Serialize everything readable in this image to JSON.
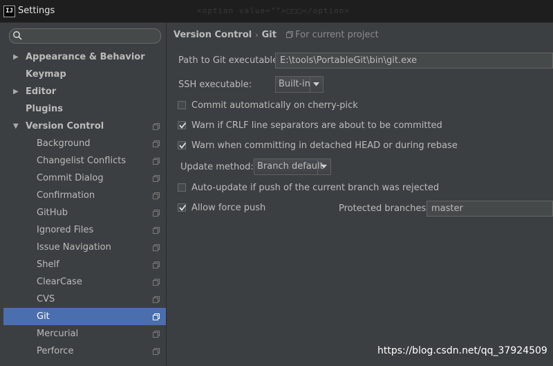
{
  "window": {
    "title": "Settings",
    "app_icon": "IJ",
    "background_code": "<option value=\"\">□□□</option>"
  },
  "sidebar": {
    "search": {
      "value": "",
      "placeholder": ""
    },
    "items": [
      {
        "label": "Appearance & Behavior",
        "level": 0,
        "arrow": "▶"
      },
      {
        "label": "Keymap",
        "level": 0
      },
      {
        "label": "Editor",
        "level": 0,
        "arrow": "▶"
      },
      {
        "label": "Plugins",
        "level": 0
      },
      {
        "label": "Version Control",
        "level": 0,
        "arrow": "▼"
      },
      {
        "label": "Background",
        "level": 1
      },
      {
        "label": "Changelist Conflicts",
        "level": 1
      },
      {
        "label": "Commit Dialog",
        "level": 1
      },
      {
        "label": "Confirmation",
        "level": 1
      },
      {
        "label": "GitHub",
        "level": 1
      },
      {
        "label": "Ignored Files",
        "level": 1
      },
      {
        "label": "Issue Navigation",
        "level": 1
      },
      {
        "label": "Shelf",
        "level": 1
      },
      {
        "label": "ClearCase",
        "level": 1
      },
      {
        "label": "CVS",
        "level": 1
      },
      {
        "label": "Git",
        "level": 1,
        "selected": true
      },
      {
        "label": "Mercurial",
        "level": 1
      },
      {
        "label": "Perforce",
        "level": 1
      }
    ]
  },
  "breadcrumb": {
    "parent": "Version Control",
    "separator": "›",
    "current": "Git",
    "scope_hint": "For current project"
  },
  "git": {
    "path_label": "Path to Git executable:",
    "path_value": "E:\\tools\\PortableGit\\bin\\git.exe",
    "ssh_label": "SSH executable:",
    "ssh_value": "Built-in",
    "commit_cherry_pick": {
      "label": "Commit automatically on cherry-pick",
      "checked": false
    },
    "warn_crlf": {
      "label": "Warn if CRLF line separators are about to be committed",
      "checked": true
    },
    "warn_detached": {
      "label": "Warn when committing in detached HEAD or during rebase",
      "checked": true
    },
    "update_method_label": "Update method:",
    "update_method_value": "Branch default",
    "auto_update": {
      "label": "Auto-update if push of the current branch was rejected",
      "checked": false
    },
    "allow_force_push": {
      "label": "Allow force push",
      "checked": true
    },
    "protected_branches_label": "Protected branches:",
    "protected_branches_value": "master"
  },
  "watermark": "https://blog.csdn.net/qq_37924509",
  "colors": {
    "background": "#3c3f41",
    "selection": "#4b6eaf",
    "titlebar": "#1e1e1e",
    "text": "#bbbbbb"
  }
}
